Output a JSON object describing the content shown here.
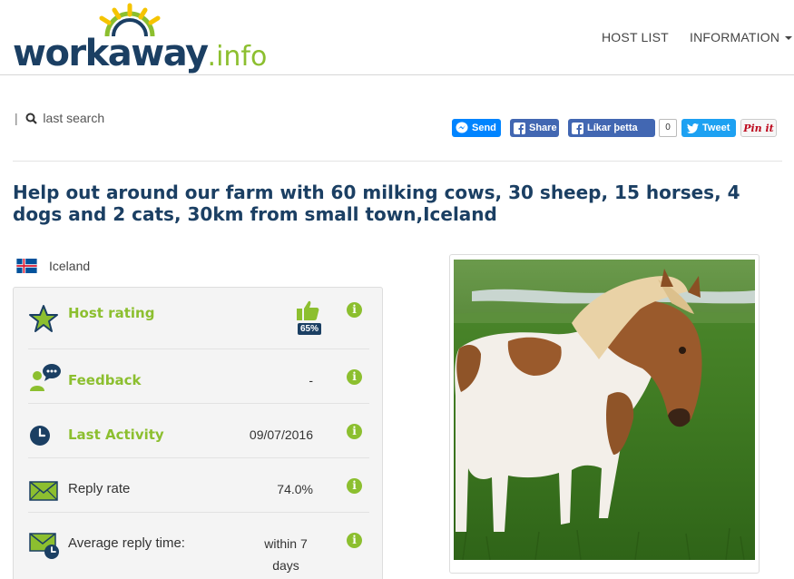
{
  "header": {
    "logo_text_main": "workaway",
    "logo_text_suffix": ".info",
    "nav": {
      "host_list": "HOST LIST",
      "information": "INFORMATION"
    }
  },
  "search_row": {
    "separator": "|",
    "last_search": "last search"
  },
  "social": {
    "send": "Send",
    "share": "Share",
    "like": "Líkar þetta",
    "like_count": "0",
    "tweet": "Tweet",
    "pin": "Pin it"
  },
  "listing": {
    "title": "Help out around our farm with 60 milking cows, 30 sheep, 15 horses, 4 dogs and 2 cats, 30km from small town,Iceland",
    "country": "Iceland",
    "rating_percent": "65%",
    "stats": [
      {
        "icon": "star-icon",
        "label": "Host rating",
        "value": ""
      },
      {
        "icon": "feedback-icon",
        "label": "Feedback",
        "value": "-"
      },
      {
        "icon": "clock-icon",
        "label": "Last Activity",
        "value": "09/07/2016"
      },
      {
        "icon": "envelope-icon",
        "label": "Reply rate",
        "value": "74.0%"
      },
      {
        "icon": "envelope-clock-icon",
        "label": "Average reply time:",
        "value": "within 7 days"
      }
    ],
    "info_glyph": "i"
  },
  "colors": {
    "brand_navy": "#1b3f63",
    "brand_green": "#8cbf2f"
  }
}
